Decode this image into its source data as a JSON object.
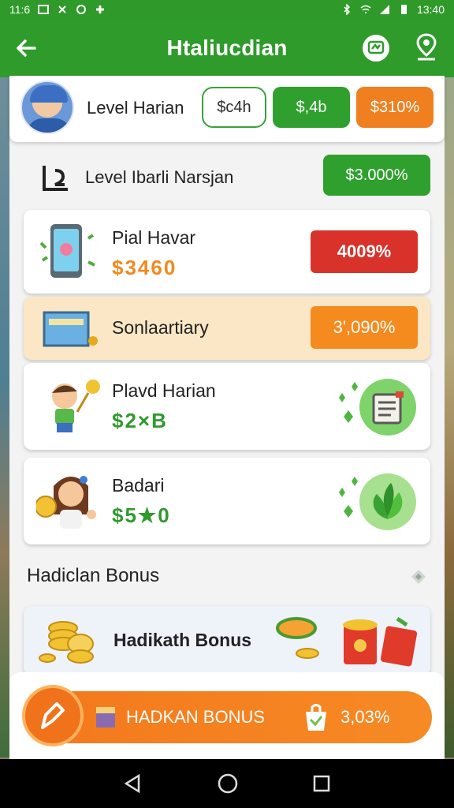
{
  "status_bar": {
    "time_left": "11:6",
    "time_right": "13:40"
  },
  "app_bar": {
    "title": "Htaliucdian"
  },
  "level_card": {
    "label": "Level Harian",
    "pill_outline": "$c4h",
    "pill_green": "$,4b",
    "pill_orange": "$310%"
  },
  "level_row": {
    "label": "Level Ibarli Narsjan",
    "button": "$3.000%"
  },
  "rewards": [
    {
      "title": "Pial Havar",
      "amount": "$3460",
      "button": "4009%"
    },
    {
      "title": "Sonlaartiary",
      "amount": "",
      "button": "3',090%"
    },
    {
      "title": "Plavd Harian",
      "amount": "$2×B",
      "button": ""
    },
    {
      "title": "Badari",
      "amount": "$5★0",
      "button": ""
    }
  ],
  "section": {
    "title": "Hadiclan Bonus"
  },
  "bonus_card": {
    "title": "Hadikath Bonus"
  },
  "bonus_bar": {
    "label": "HADKAN BONUS",
    "value": "3,03%"
  },
  "colors": {
    "primary_green": "#2e9b2b",
    "orange": "#f07f1f",
    "red": "#d9322a"
  }
}
